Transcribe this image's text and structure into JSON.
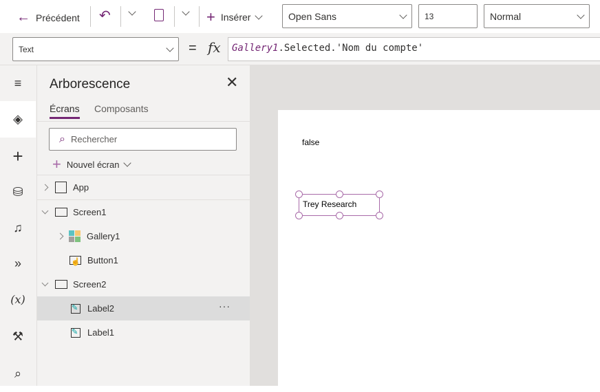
{
  "toolbar": {
    "back_label": "Précédent",
    "insert_label": "Insérer",
    "font": "Open Sans",
    "size": "13",
    "weight": "Normal"
  },
  "formula": {
    "property": "Text",
    "fx": "fx",
    "equals": "=",
    "expr_gallery": "Gallery1",
    "expr_rest": ".Selected.'Nom du compte'"
  },
  "panel": {
    "title": "Arborescence",
    "tabs": [
      "Écrans",
      "Composants"
    ],
    "search_placeholder": "Rechercher",
    "new_screen": "Nouvel écran",
    "tree": [
      {
        "label": "App"
      },
      {
        "label": "Screen1"
      },
      {
        "label": "Gallery1"
      },
      {
        "label": "Button1"
      },
      {
        "label": "Screen2"
      },
      {
        "label": "Label2",
        "more": "···"
      },
      {
        "label": "Label1"
      }
    ]
  },
  "canvas": {
    "false_text": "false",
    "label_text": "Trey Research"
  },
  "colors": {
    "accent": "#742774"
  }
}
